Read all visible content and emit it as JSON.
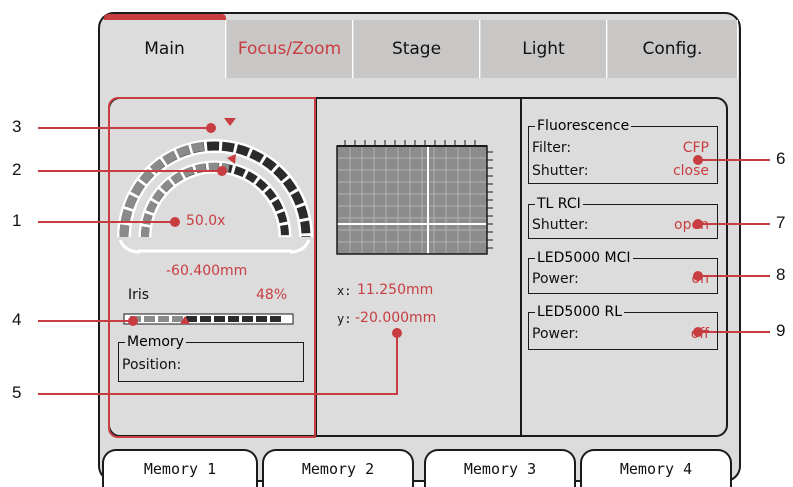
{
  "tabs": [
    {
      "label": "Main"
    },
    {
      "label": "Focus/Zoom"
    },
    {
      "label": "Stage"
    },
    {
      "label": "Light"
    },
    {
      "label": "Config."
    }
  ],
  "zoom": {
    "magnification": "50.0x",
    "focus_position": "-60.400mm"
  },
  "iris": {
    "label": "Iris",
    "value": "48%",
    "level": 0.48
  },
  "memory_box": {
    "title": "Memory",
    "position_label": "Position:"
  },
  "stage": {
    "x_label": "x:",
    "x_value": "11.250mm",
    "y_label": "y:",
    "y_value": "-20.000mm"
  },
  "fluorescence": {
    "title": "Fluorescence",
    "filter_label": "Filter:",
    "filter_value": "CFP",
    "shutter_label": "Shutter:",
    "shutter_value": "close"
  },
  "tl_rci": {
    "title": "TL RCI",
    "shutter_label": "Shutter:",
    "shutter_value": "open"
  },
  "led_mci": {
    "title": "LED5000 MCI",
    "power_label": "Power:",
    "power_value": "on"
  },
  "led_rl": {
    "title": "LED5000 RL",
    "power_label": "Power:",
    "power_value": "off"
  },
  "memory_buttons": [
    {
      "label": "Memory 1"
    },
    {
      "label": "Memory 2"
    },
    {
      "label": "Memory 3"
    },
    {
      "label": "Memory 4"
    }
  ],
  "callouts": [
    "1",
    "2",
    "3",
    "4",
    "5",
    "6",
    "7",
    "8",
    "9"
  ],
  "colors": {
    "accent": "#c83d41",
    "panel": "#dcdcdc",
    "tab_inactive": "#c9c6c6",
    "border": "#1a1a1a"
  }
}
